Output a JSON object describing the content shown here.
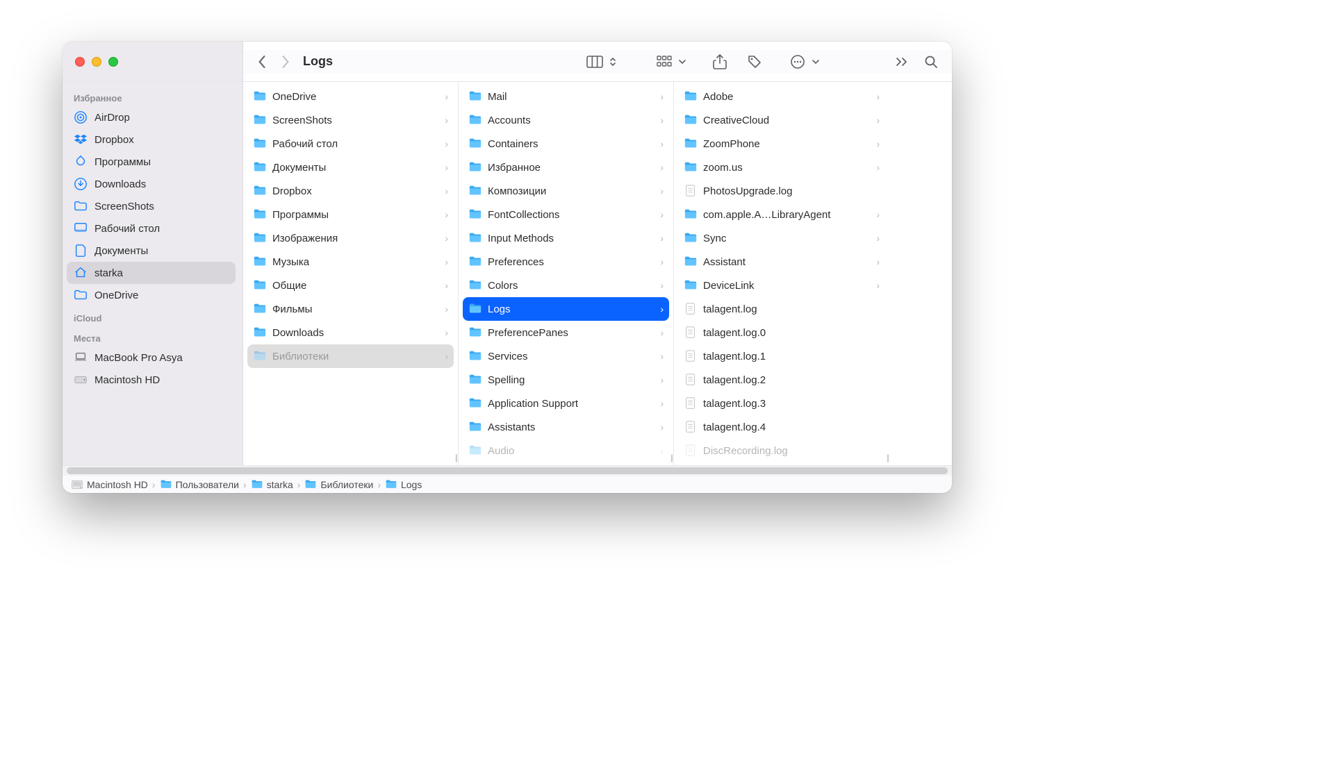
{
  "title": "Logs",
  "sidebar": {
    "sections": [
      {
        "header": "Избранное",
        "items": [
          {
            "icon": "airdrop",
            "label": "AirDrop"
          },
          {
            "icon": "dropbox",
            "label": "Dropbox"
          },
          {
            "icon": "apps",
            "label": "Программы"
          },
          {
            "icon": "downloads",
            "label": "Downloads"
          },
          {
            "icon": "folder-o",
            "label": "ScreenShots"
          },
          {
            "icon": "desktop",
            "label": "Рабочий стол"
          },
          {
            "icon": "doc",
            "label": "Документы"
          },
          {
            "icon": "home",
            "label": "starka",
            "selected": true
          },
          {
            "icon": "folder-o",
            "label": "OneDrive"
          }
        ]
      },
      {
        "header": "iCloud",
        "items": []
      },
      {
        "header": "Места",
        "items": [
          {
            "icon": "laptop",
            "label": "MacBook Pro Asya",
            "mono": true
          },
          {
            "icon": "hdd",
            "label": "Macintosh HD",
            "mono": true
          }
        ]
      }
    ]
  },
  "columns": [
    {
      "items": [
        {
          "type": "folder",
          "label": "OneDrive",
          "chev": true,
          "tint": "cloud"
        },
        {
          "type": "folder",
          "label": "ScreenShots",
          "chev": true
        },
        {
          "type": "folder",
          "label": "Рабочий стол",
          "chev": true
        },
        {
          "type": "folder",
          "label": "Документы",
          "chev": true
        },
        {
          "type": "folder",
          "label": "Dropbox",
          "chev": true,
          "tint": "dropbox"
        },
        {
          "type": "folder",
          "label": "Программы",
          "chev": true
        },
        {
          "type": "folder",
          "label": "Изображения",
          "chev": true
        },
        {
          "type": "folder",
          "label": "Музыка",
          "chev": true,
          "tint": "music"
        },
        {
          "type": "folder",
          "label": "Общие",
          "chev": true,
          "tint": "shared"
        },
        {
          "type": "folder",
          "label": "Фильмы",
          "chev": true,
          "tint": "movie"
        },
        {
          "type": "folder",
          "label": "Downloads",
          "chev": true
        },
        {
          "type": "folder",
          "label": "Библиотеки",
          "chev": true,
          "sel": "inactive",
          "dimmed": true
        }
      ]
    },
    {
      "items": [
        {
          "type": "folder",
          "label": "Mail",
          "chev": true
        },
        {
          "type": "folder",
          "label": "Accounts",
          "chev": true
        },
        {
          "type": "folder",
          "label": "Containers",
          "chev": true
        },
        {
          "type": "folder",
          "label": "Избранное",
          "chev": true
        },
        {
          "type": "folder",
          "label": "Композиции",
          "chev": true
        },
        {
          "type": "folder",
          "label": "FontCollections",
          "chev": true
        },
        {
          "type": "folder",
          "label": "Input Methods",
          "chev": true
        },
        {
          "type": "folder",
          "label": "Preferences",
          "chev": true
        },
        {
          "type": "folder",
          "label": "Colors",
          "chev": true
        },
        {
          "type": "folder",
          "label": "Logs",
          "chev": true,
          "sel": "active"
        },
        {
          "type": "folder",
          "label": "PreferencePanes",
          "chev": true
        },
        {
          "type": "folder",
          "label": "Services",
          "chev": true
        },
        {
          "type": "folder",
          "label": "Spelling",
          "chev": true
        },
        {
          "type": "folder",
          "label": "Application Support",
          "chev": true
        },
        {
          "type": "folder",
          "label": "Assistants",
          "chev": true
        },
        {
          "type": "folder",
          "label": "Audio",
          "chev": true,
          "cut": true
        }
      ]
    },
    {
      "items": [
        {
          "type": "folder",
          "label": "Adobe",
          "chev": true
        },
        {
          "type": "folder",
          "label": "CreativeCloud",
          "chev": true
        },
        {
          "type": "folder",
          "label": "ZoomPhone",
          "chev": true
        },
        {
          "type": "folder",
          "label": "zoom.us",
          "chev": true
        },
        {
          "type": "file",
          "label": "PhotosUpgrade.log"
        },
        {
          "type": "folder",
          "label": "com.apple.A…LibraryAgent",
          "chev": true
        },
        {
          "type": "folder",
          "label": "Sync",
          "chev": true
        },
        {
          "type": "folder",
          "label": "Assistant",
          "chev": true
        },
        {
          "type": "folder",
          "label": "DeviceLink",
          "chev": true
        },
        {
          "type": "file",
          "label": "talagent.log"
        },
        {
          "type": "file",
          "label": "talagent.log.0"
        },
        {
          "type": "file",
          "label": "talagent.log.1"
        },
        {
          "type": "file",
          "label": "talagent.log.2"
        },
        {
          "type": "file",
          "label": "talagent.log.3"
        },
        {
          "type": "file",
          "label": "talagent.log.4"
        },
        {
          "type": "file",
          "label": "DiscRecording.log",
          "cut": true
        }
      ]
    }
  ],
  "path": [
    {
      "icon": "hdd",
      "label": "Macintosh HD"
    },
    {
      "icon": "folder",
      "label": "Пользователи"
    },
    {
      "icon": "folder",
      "label": "starka"
    },
    {
      "icon": "folder",
      "label": "Библиотеки"
    },
    {
      "icon": "folder",
      "label": "Logs"
    }
  ]
}
